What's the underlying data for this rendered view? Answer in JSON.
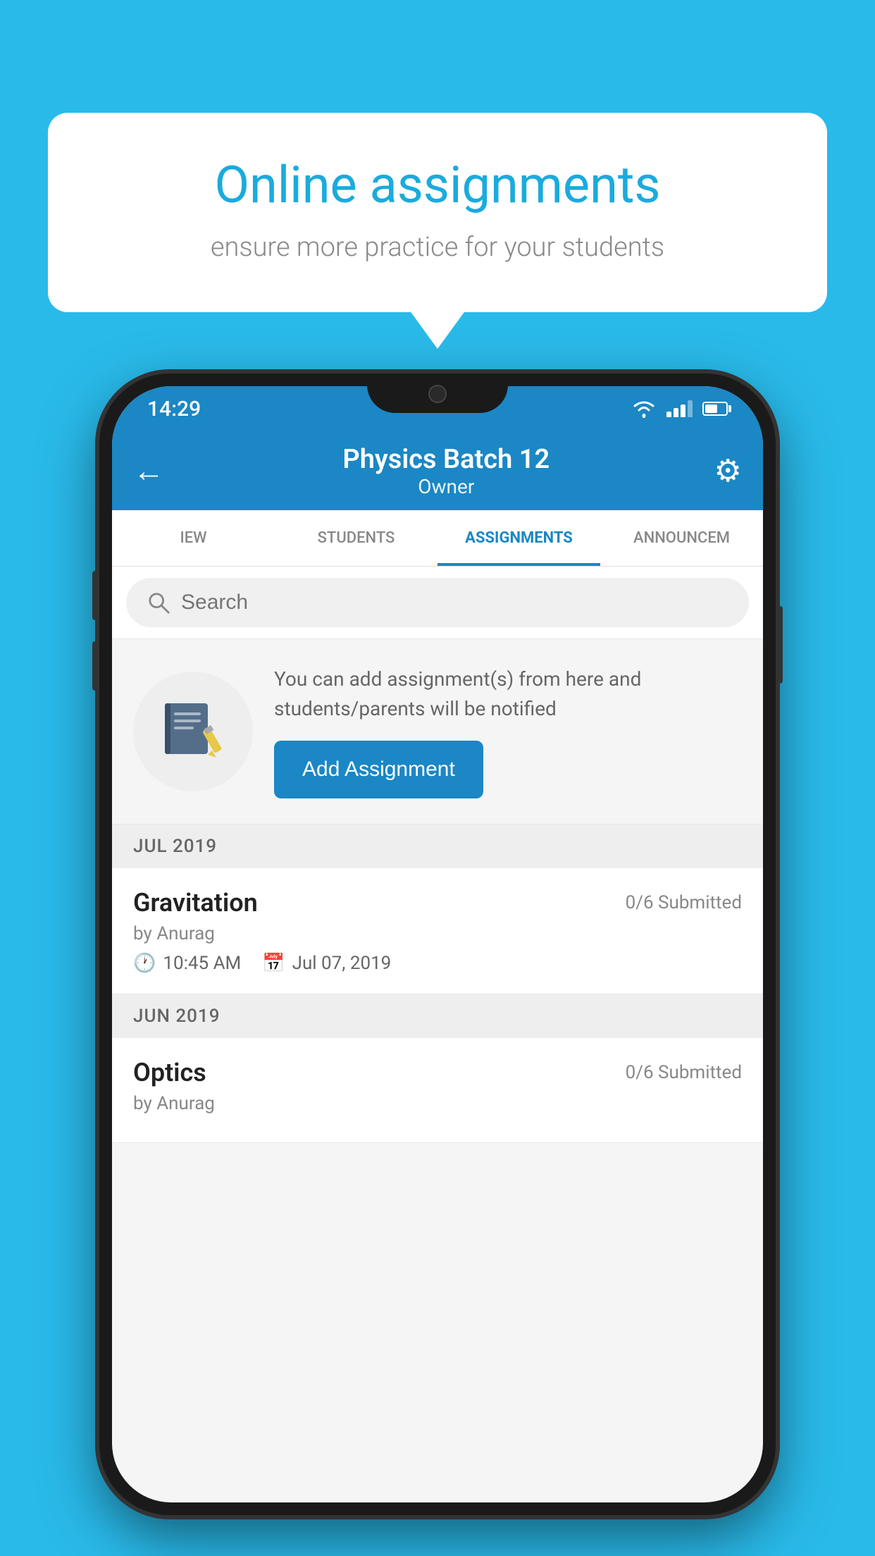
{
  "background_color": "#00AADD",
  "speech_bubble": {
    "title": "Online assignments",
    "subtitle": "ensure more practice for your students"
  },
  "status_bar": {
    "time": "14:29"
  },
  "app_bar": {
    "title": "Physics Batch 12",
    "subtitle": "Owner",
    "back_label": "←",
    "gear_label": "⚙"
  },
  "tabs": [
    {
      "label": "IEW",
      "active": false
    },
    {
      "label": "STUDENTS",
      "active": false
    },
    {
      "label": "ASSIGNMENTS",
      "active": true
    },
    {
      "label": "ANNOUNCEME",
      "active": false
    }
  ],
  "search": {
    "placeholder": "Search"
  },
  "promo": {
    "description": "You can add assignment(s) from here and students/parents will be notified",
    "button_label": "Add Assignment"
  },
  "sections": [
    {
      "month": "JUL 2019",
      "assignments": [
        {
          "name": "Gravitation",
          "submitted": "0/6 Submitted",
          "by": "by Anurag",
          "time": "10:45 AM",
          "date": "Jul 07, 2019"
        }
      ]
    },
    {
      "month": "JUN 2019",
      "assignments": [
        {
          "name": "Optics",
          "submitted": "0/6 Submitted",
          "by": "by Anurag",
          "time": "",
          "date": ""
        }
      ]
    }
  ]
}
